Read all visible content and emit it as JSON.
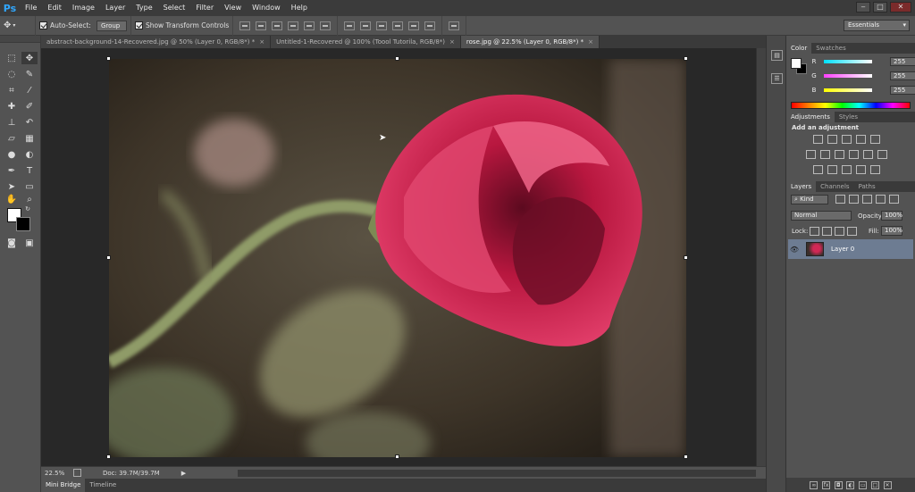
{
  "app": {
    "logo": "Ps"
  },
  "menu": [
    "File",
    "Edit",
    "Image",
    "Layer",
    "Type",
    "Select",
    "Filter",
    "View",
    "Window",
    "Help"
  ],
  "window_controls": {
    "minimize": "‒",
    "maximize": "□",
    "close": "✕"
  },
  "options_bar": {
    "auto_select_label": "Auto-Select:",
    "auto_select_checked": true,
    "auto_select_value": "Group",
    "transform_label": "Show Transform Controls",
    "transform_checked": true
  },
  "workspace": {
    "selected": "Essentials"
  },
  "tabs": [
    {
      "label": "abstract-background-14-Recovered.jpg @ 50% (Layer 0, RGB/8*) *",
      "close": "×",
      "active": false
    },
    {
      "label": "Untitled-1-Recovered @ 100% (Toool Tutorila, RGB/8*)",
      "close": "×",
      "active": false
    },
    {
      "label": "rose.jpg @ 22.5% (Layer 0, RGB/8*) *",
      "close": "×",
      "active": true
    }
  ],
  "status": {
    "zoom": "22.5%",
    "doc": "Doc: 39.7M/39.7M"
  },
  "bottom_tabs": [
    "Mini Bridge",
    "Timeline"
  ],
  "color_panel": {
    "tabs": [
      "Color",
      "Swatches"
    ],
    "channels": [
      {
        "label": "R",
        "value": "255",
        "gradient": "#00e0ff"
      },
      {
        "label": "G",
        "value": "255",
        "gradient": "#ff40ff"
      },
      {
        "label": "B",
        "value": "255",
        "gradient": "#ffff00"
      }
    ],
    "foreground": "#ffffff",
    "background": "#000000"
  },
  "adjustments_panel": {
    "tabs": [
      "Adjustments",
      "Styles"
    ],
    "heading": "Add an adjustment"
  },
  "layers_panel": {
    "tabs": [
      "Layers",
      "Channels",
      "Paths"
    ],
    "filter_kind": "Kind",
    "blend_mode": "Normal",
    "opacity_label": "Opacity:",
    "opacity_value": "100%",
    "lock_label": "Lock:",
    "fill_label": "Fill:",
    "fill_value": "100%",
    "layers": [
      {
        "name": "Layer 0",
        "visible": true,
        "selected": true
      }
    ]
  },
  "colors": {
    "accent_blue": "#31a8ff",
    "selected_layer": "#6d7c92",
    "rose": "#d12855"
  }
}
